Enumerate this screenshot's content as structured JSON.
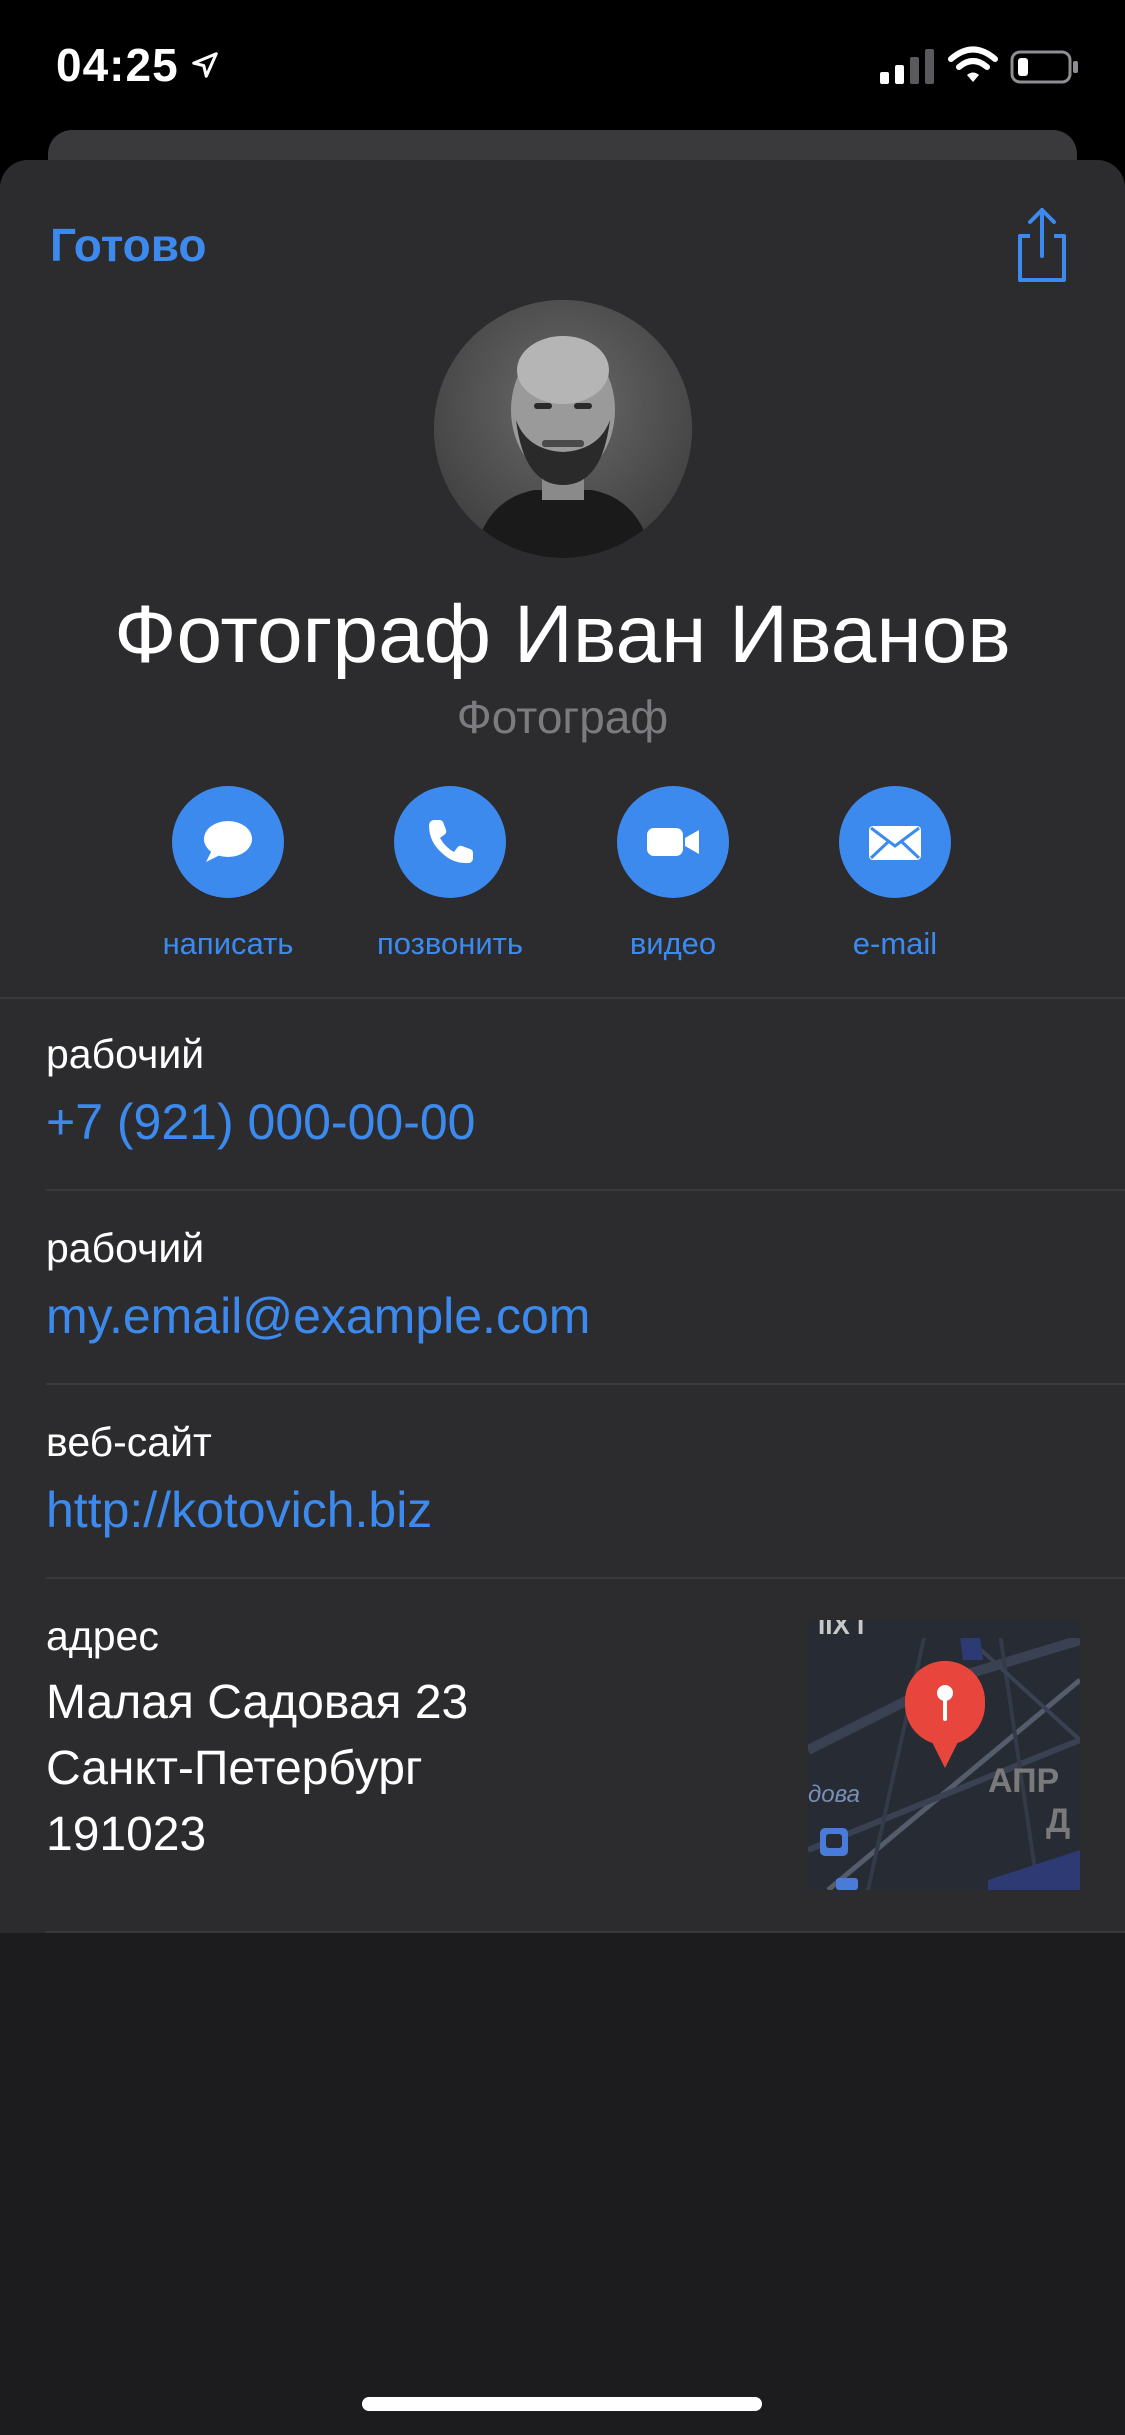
{
  "status": {
    "time": "04:25"
  },
  "header": {
    "done_label": "Готово"
  },
  "contact": {
    "name": "Фотограф Иван Иванов",
    "subtitle": "Фотограф"
  },
  "actions": [
    {
      "label": "написать",
      "icon": "message-icon"
    },
    {
      "label": "позвонить",
      "icon": "phone-icon"
    },
    {
      "label": "видео",
      "icon": "video-icon"
    },
    {
      "label": "e-mail",
      "icon": "mail-icon"
    }
  ],
  "fields": {
    "phone": {
      "label": "рабочий",
      "value": "+7 (921) 000-00-00"
    },
    "email": {
      "label": "рабочий",
      "value": "my.email@example.com"
    },
    "website": {
      "label": "веб-сайт",
      "value": "http://kotovich.biz"
    },
    "address": {
      "label": "адрес",
      "lines": [
        "Малая Садовая 23",
        "Санкт-Петербург",
        "191023"
      ]
    }
  },
  "map": {
    "label_left": "дова",
    "label_right_1": "АПР",
    "label_right_2": "Д",
    "pin_color": "#e8453c"
  },
  "colors": {
    "accent": "#3d8aef",
    "card": "#2c2c2e",
    "background": "#1c1c1e"
  }
}
